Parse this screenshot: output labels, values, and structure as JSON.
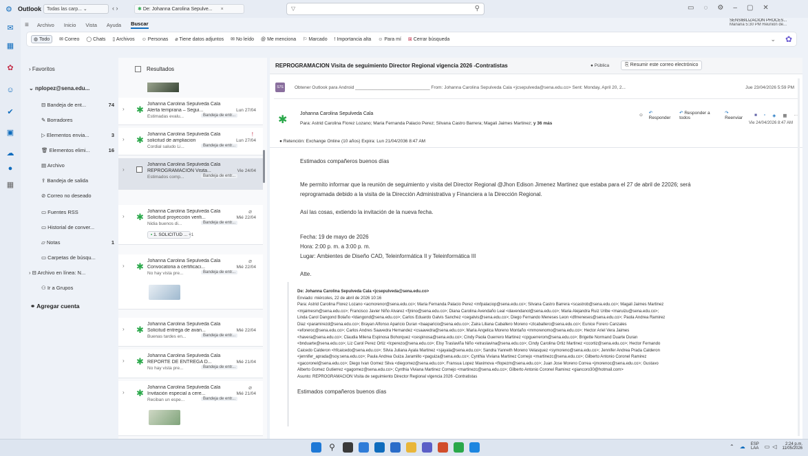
{
  "titlebar": {
    "app_title": "Outlook",
    "folder_dropdown": "Todas las carp...",
    "tab_title": "De: Johanna Carolina Sepulve...",
    "tab_close": "×",
    "nav_arrows": "‹ ›"
  },
  "ribbon_tabs": [
    "Archivo",
    "Inicio",
    "Vista",
    "Ayuda",
    "Buscar"
  ],
  "ribbon_active": "Buscar",
  "reminder": {
    "title": "SENSIBILIZACION PROCES...",
    "detail": "Mañana 5:30 PM Reunión de..."
  },
  "filters": [
    "Todo",
    "Correo",
    "Chats",
    "Archivos",
    "Personas",
    "Tiene datos adjuntos",
    "No leído",
    "Me menciona",
    "Marcado",
    "Importancia alta",
    "Para mí",
    "Cerrar búsqueda"
  ],
  "folders": {
    "favoritos": "Favoritos",
    "account": "nplopez@sena.edu...",
    "items": [
      {
        "label": "Bandeja de ent...",
        "count": "74"
      },
      {
        "label": "Borradores",
        "count": ""
      },
      {
        "label": "Elementos envia...",
        "count": "3"
      },
      {
        "label": "Elementos elimi...",
        "count": "16"
      },
      {
        "label": "Archivo",
        "count": ""
      },
      {
        "label": "Bandeja de salida",
        "count": ""
      },
      {
        "label": "Correo no deseado",
        "count": ""
      },
      {
        "label": "Fuentes RSS",
        "count": ""
      },
      {
        "label": "Historial de conver...",
        "count": ""
      },
      {
        "label": "Notas",
        "count": "1"
      },
      {
        "label": "Carpetas de búsqu...",
        "count": ""
      },
      {
        "label": "Archivo en línea: N...",
        "count": ""
      },
      {
        "label": "Ir a Grupos",
        "count": ""
      }
    ],
    "add_account": "Agregar cuenta"
  },
  "list": {
    "header": "Resultados",
    "messages": [
      {
        "sender": "Johanna Carolina Sepulveda Cala",
        "subject": "Alerta temprana – Segui...",
        "date": "Lun 27/04",
        "preview": "Estimadas evalu...",
        "folder": "Bandeja de entr..."
      },
      {
        "sender": "Johanna Carolina Sepulveda Cala",
        "subject": "solicitud de ampliacion",
        "date": "Lun 27/04",
        "preview": "Cordial saludo Li...",
        "folder": "Bandeja de entr..."
      },
      {
        "sender": "Johanna Carolina Sepulveda Cala",
        "subject": "REPROGRAMACION Visita...",
        "date": "Vie 24/04",
        "preview": "Estimados comp...",
        "folder": "Bandeja de entr..."
      },
      {
        "sender": "Johanna Carolina Sepulveda Cala",
        "subject": "Solicitud proyección verifi...",
        "date": "Mié 22/04",
        "preview": "Nidia buenos di...",
        "folder": "Bandeja de entr...",
        "attachment": "1. SOLICITUD ...",
        "extra": "+1"
      },
      {
        "sender": "Johanna Carolina Sepulveda Cala",
        "subject": "Convocatoria a certificaci...",
        "date": "Mié 22/04",
        "preview": "No hay vista pre...",
        "folder": "Bandeja de entr..."
      },
      {
        "sender": "Johanna Carolina Sepulveda Cala",
        "subject": "Solicitud entrega de avan...",
        "date": "Mié 22/04",
        "preview": "Buenas tardes en...",
        "folder": "Bandeja de entr..."
      },
      {
        "sender": "Johanna Carolina Sepulveda Cala",
        "subject": "REPORTE DE ENTREGA D...",
        "date": "Mié 21/04",
        "preview": "No hay vista pre...",
        "folder": "Bandeja de entr..."
      },
      {
        "sender": "Johanna Carolina Sepulveda Cala",
        "subject": "Invitación especial a cere...",
        "date": "Mié 21/04",
        "preview": "Reciban un espe...",
        "folder": "Bandeja de entr..."
      }
    ]
  },
  "reading": {
    "subject": "REPROGRAMACION  Visita de seguimiento Director Regional vigencia 2026 -Contratistas",
    "public_badge": "Pública",
    "summarize": "Resumir este correo electrónico",
    "collapsed_line": "Obtener Outlook para Android ______________________________ From: Johanna Carolina Sepulveda Cala <jcsepulveda@sena.edu.co> Sent: Monday, April 20, 2...",
    "collapsed_date": "Jue 23/04/2026 5:59 PM",
    "sender": "Johanna Carolina Sepulveda Cala",
    "reply": "Responder",
    "reply_all": "Responder a todos",
    "forward": "Reenviar",
    "to_line": "Para:  Astrid Carolina Florez Lozano;  Maria Fernanda Palacio Perez;  Silvana Castro Barrera;  Magali Jaimes Martinez;",
    "to_more": "y 36 más",
    "date": "Vie 24/04/2026 8:47 AM",
    "retention": "Retención: Exchange Online (10 años) Expira: Lun 21/04/2036 8:47 AM",
    "body": [
      "Estimados compañeros buenos días",
      "Me permito informar que la reunión de seguimiento y visita del Director Regional @Jhon Edison Jimenez Martinez  que estaba para el 27 de abril de 22026;  será",
      "reprogramada debido a la visita de la Dirección Administrativa y Financiera a la Dirección Regional.",
      "Así las cosas, extiendo la invitación de la nueva fecha.",
      "Fecha: 19 de mayo de 2026",
      "Hora: 2:00 p. m. a 3:00 p. m.",
      "Lugar: Ambientes de Diseño CAD, Teleinformática II y Teleinformática III",
      "Atte."
    ],
    "quoted": {
      "de": "De: Johanna Carolina Sepulveda Cala <jcsepulveda@sena.edu.co>",
      "enviado": "Enviado: miércoles, 22 de abril de 2026 10:16",
      "para": [
        "Para: Astrid Carolina Florez Lozano <acmorenor@sena.edu.co>; Maria Fernanda Palacio Perez <mfpalaciop@sena.edu.co>; Silvana Castro Barrera <scastrob@sena.edu.co>; Magali Jaimes Martinez",
        "<mjaimesm@sena.edu.co>; Francisco Javier Niño Alvarez <fjnino@sena.edu.co>; Diana Carolina Avendaño Leal <davendanol@sena.edu.co>; Maria Alejandra Ruiz Uribe <maruizu@sena.edu.co>;",
        "Linda Carol Dangond Bolaño <ldangond@sena.edu.co>; Carlos Eduardo Galvis Sanchez <cegalvis@sena.edu.co>; Diego Fernando Meneses Leon <dfmeneses@sena.edu.co>; Paola Andrea Ramirez",
        "Diaz <paramirezd@sena.edu.co>; Brayan Alfonso Aparicio Duran <baaparicio@sena.edu.co>; Zaira Liliana Caballero Moreno <zlcaballero@sena.edu.co>; Eunice Forero Canzales",
        "<eforeroc@sena.edu.co>; Carlos Andres Saavedra Hernandez <csaavedra@sena.edu.co>; Maria Angelica Moreno Montaño <mmorenomo@sena.edu.co>; Hector Ariel Vera Jaimes",
        "<havera@sena.edu.co>; Claudia Milena Espinosa Bohorquez <cespinosa@sena.edu.co>; Cindy Paola Guerrero Martinez <cpguerrerom@sena.edu.co>; Brigette Normand Duarte Duran",
        "<bnduarte@sena.edu.co>; Liz Carol Perez Ortiz <lcperezo@sena.edu.co>; Elsy Traslaviña Niño <etraslavina@sena.edu.co>; Cindy Carolina Ortiz Martinez <ccortiz@sena.edu.co>; Hector Fernando",
        "Caicedo Calderon <hfcaicedo@sena.edu.co>; Silvia Juliana Ayala Martinez <sjayala@sena.edu.co>; Sandra Yanneth Moreno Velasquez <symoreno@sena.edu.co>; Jennifer Andrea Prada Calderon",
        "<jennifer_aprada@soy.sena.edu.co>; Paula Andrea Guiza Jaramillo <paguiza@sena.edu.co>; Cynthia Viviana Martinez Cornejo <martinezc@sena.edu.co>; Gilberto Antonio Coronel Ramirez",
        "<gacoronel@sena.edu.co>; Diego Ivan Gomez Silva <diegomez@sena.edu.co>; Fransua Lopez Maximova <flopezm@sena.edu.co>; Juan Jose Moreno Correa <jmorenoc@sena.edu.co>; Gustavo",
        "Alberto Gomez Gutierrez <gagomez@sena.edu.co>; Cynthia Viviana Martinez Cornejo <martinezc@sena.edu.co>; Gilberto Antonio Coronel Ramirez <giancoro30@hotmail.com>"
      ],
      "asunto": "Asunto: REPROGRAMACION Visita de seguimiento Director Regional vigencia 2026 -Contratistas",
      "closing": "Estimados compañeros buenos días"
    }
  },
  "tray": {
    "lang": "ESP",
    "lang2": "LAA",
    "time": "2:24 p.m.",
    "date": "11/05/2026"
  },
  "colors": {
    "accent": "#0f6cbd",
    "avatar_green": "#2aa84a"
  }
}
